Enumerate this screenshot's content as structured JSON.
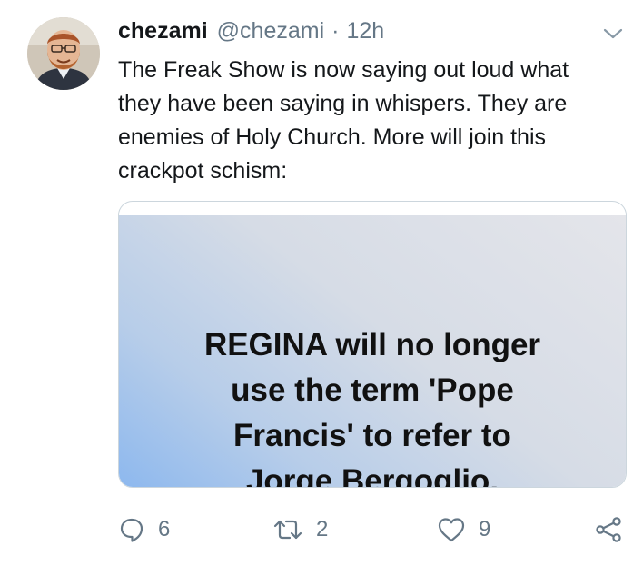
{
  "tweet": {
    "display_name": "chezami",
    "handle": "@chezami",
    "separator": "·",
    "time": "12h",
    "text_lines": [
      "The Freak Show is now saying out loud what",
      "they have been saying in whispers.  They are",
      "enemies of Holy Church.  More will join this",
      "crackpot schism:"
    ],
    "media_text_lines": [
      "REGINA will no longer",
      "use the term 'Pope",
      "Francis' to refer to",
      "Jorge Bergoglio."
    ],
    "actions": {
      "reply_count": "6",
      "retweet_count": "2",
      "like_count": "9"
    }
  },
  "icons": {
    "caret": "chevron-down-icon",
    "reply": "reply-icon",
    "retweet": "retweet-icon",
    "like": "heart-icon",
    "share": "share-icon"
  },
  "colors": {
    "text": "#14171a",
    "secondary": "#657786",
    "border": "#ccd6dd"
  }
}
